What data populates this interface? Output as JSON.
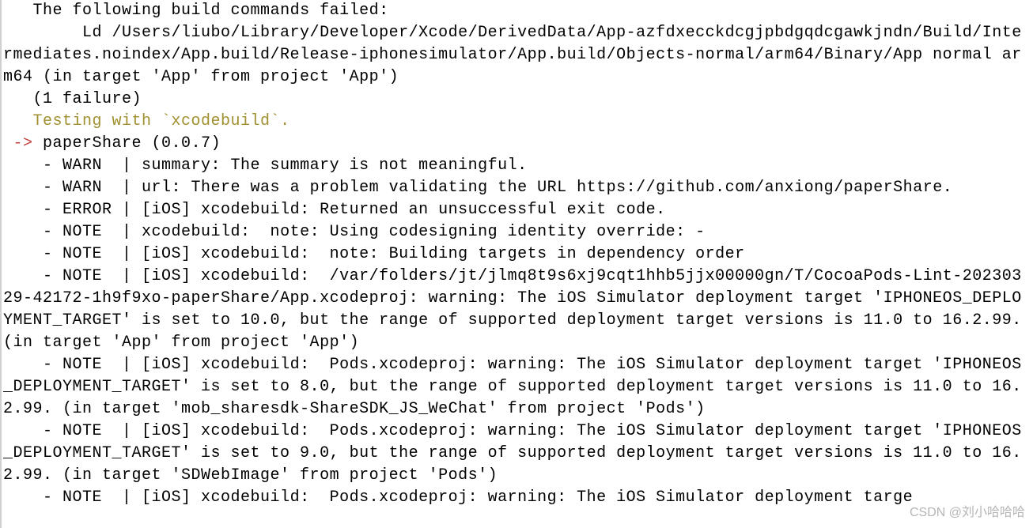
{
  "terminal": {
    "line01": "   The following build commands failed:",
    "line02": "        Ld /Users/liubo/Library/Developer/Xcode/DerivedData/App-azfdxecckdcgjpbdgqdcgawkjndn/Build/Intermediates.noindex/App.build/Release-iphonesimulator/App.build/Objects-normal/arm64/Binary/App normal arm64 (in target 'App' from project 'App')",
    "line03": "   (1 failure)",
    "line04": "   Testing with `xcodebuild`.",
    "arrow": " ->",
    "line05": " paperShare (0.0.7)",
    "line06": "    - WARN  | summary: The summary is not meaningful.",
    "line07": "    - WARN  | url: There was a problem validating the URL https://github.com/anxiong/paperShare.",
    "line08": "    - ERROR | [iOS] xcodebuild: Returned an unsuccessful exit code.",
    "line09": "    - NOTE  | xcodebuild:  note: Using codesigning identity override: -",
    "line10": "    - NOTE  | [iOS] xcodebuild:  note: Building targets in dependency order",
    "line11": "    - NOTE  | [iOS] xcodebuild:  /var/folders/jt/jlmq8t9s6xj9cqt1hhb5jjx00000gn/T/CocoaPods-Lint-20230329-42172-1h9f9xo-paperShare/App.xcodeproj: warning: The iOS Simulator deployment target 'IPHONEOS_DEPLOYMENT_TARGET' is set to 10.0, but the range of supported deployment target versions is 11.0 to 16.2.99. (in target 'App' from project 'App')",
    "line12": "    - NOTE  | [iOS] xcodebuild:  Pods.xcodeproj: warning: The iOS Simulator deployment target 'IPHONEOS_DEPLOYMENT_TARGET' is set to 8.0, but the range of supported deployment target versions is 11.0 to 16.2.99. (in target 'mob_sharesdk-ShareSDK_JS_WeChat' from project 'Pods')",
    "line13": "    - NOTE  | [iOS] xcodebuild:  Pods.xcodeproj: warning: The iOS Simulator deployment target 'IPHONEOS_DEPLOYMENT_TARGET' is set to 9.0, but the range of supported deployment target versions is 11.0 to 16.2.99. (in target 'SDWebImage' from project 'Pods')",
    "line14": "    - NOTE  | [iOS] xcodebuild:  Pods.xcodeproj: warning: The iOS Simulator deployment targe"
  },
  "watermark": "CSDN @刘小哈哈哈"
}
